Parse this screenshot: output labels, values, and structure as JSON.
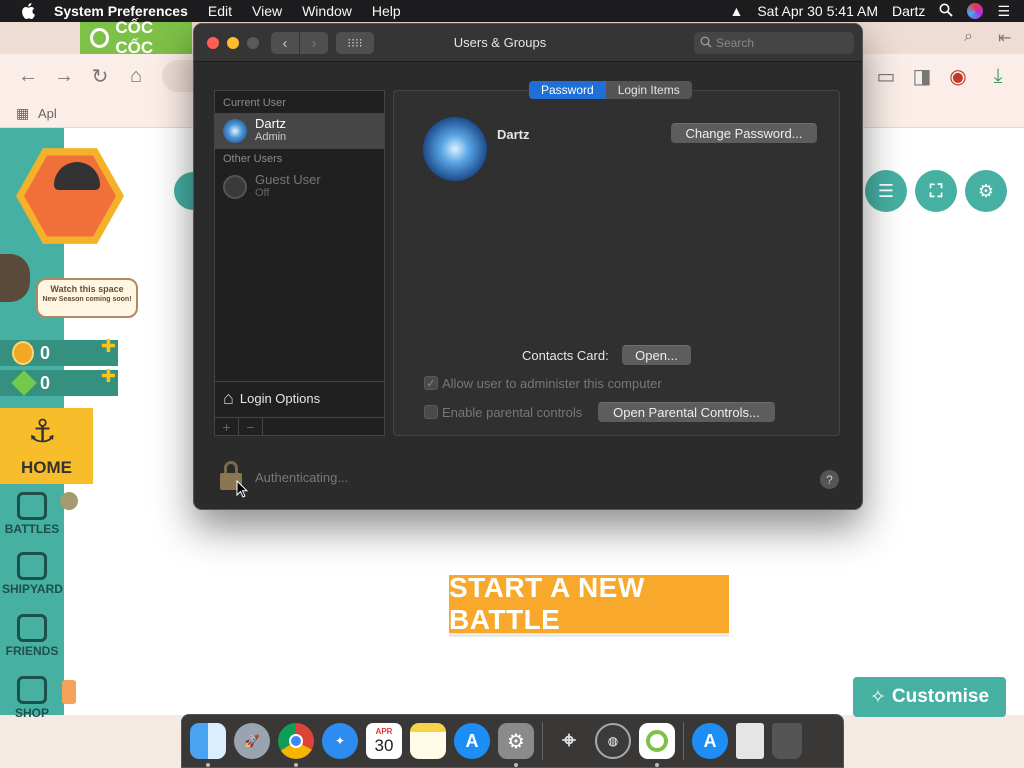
{
  "menubar": {
    "app_name": "System Preferences",
    "items": [
      "Edit",
      "View",
      "Window",
      "Help"
    ],
    "clock": "Sat Apr 30  5:41 AM",
    "user": "Dartz"
  },
  "browser": {
    "tab_label": "CỐC CỐC",
    "bookmark": "Apl"
  },
  "game": {
    "speech_line1": "Watch this space",
    "speech_line2": "New Season coming soon!",
    "coins": "0",
    "gems": "0",
    "nav": {
      "home": "HOME",
      "battles": "BATTLES",
      "shipyard": "SHIPYARD",
      "friends": "FRIENDS",
      "shop": "SHOP"
    },
    "start_battle": "START A NEW BATTLE",
    "customise": "Customise"
  },
  "window": {
    "title": "Users & Groups",
    "search_placeholder": "Search",
    "sidebar": {
      "current_user_header": "Current User",
      "current_user": {
        "name": "Dartz",
        "role": "Admin"
      },
      "other_users_header": "Other Users",
      "guest_user": {
        "name": "Guest User",
        "status": "Off"
      },
      "login_options": "Login Options"
    },
    "tabs": [
      "Password",
      "Login Items"
    ],
    "user_name": "Dartz",
    "change_password": "Change Password...",
    "contacts_card_label": "Contacts Card:",
    "open_button": "Open...",
    "allow_admin": "Allow user to administer this computer",
    "enable_parental": "Enable parental controls",
    "open_parental": "Open Parental Controls...",
    "authenticating": "Authenticating...",
    "help": "?"
  },
  "dock": {
    "calendar_month": "APR",
    "calendar_day": "30"
  }
}
